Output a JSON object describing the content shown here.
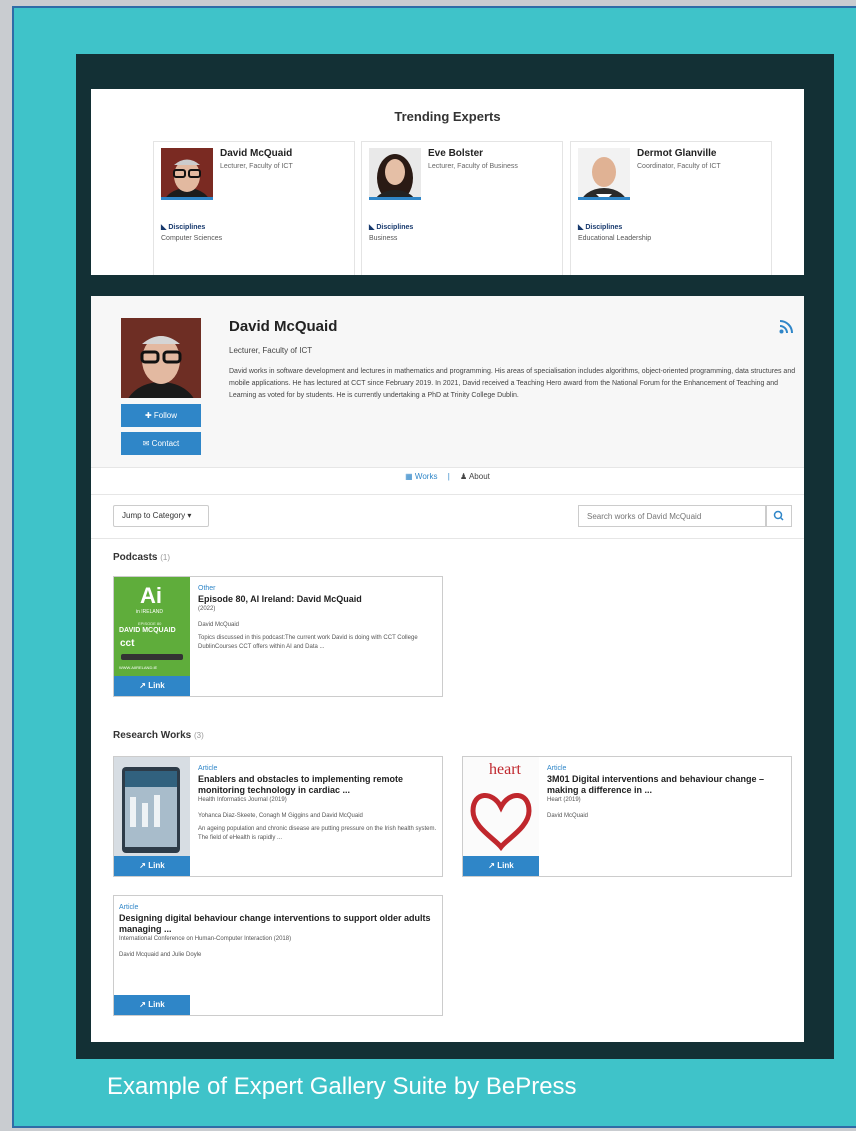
{
  "trending": {
    "title": "Trending Experts",
    "disciplines_label": "Disciplines",
    "experts": [
      {
        "name": "David McQuaid",
        "role": "Lecturer, Faculty of ICT",
        "discipline": "Computer Sciences"
      },
      {
        "name": "Eve Bolster",
        "role": "Lecturer, Faculty of Business",
        "discipline": "Business"
      },
      {
        "name": "Dermot Glanville",
        "role": "Coordinator, Faculty of ICT",
        "discipline": "Educational Leadership"
      }
    ]
  },
  "profile": {
    "name": "David McQuaid",
    "role": "Lecturer, Faculty of ICT",
    "bio": "David works in software development and lectures in mathematics and programming. His areas of specialisation includes algorithms, object-oriented programming, data structures and mobile applications. He has lectured at CCT since February 2019. In 2021, David received a Teaching Hero award from the National Forum for the Enhancement of Teaching and Learning as voted for by students. He is currently undertaking a PhD at Trinity College Dublin.",
    "follow_label": "Follow",
    "contact_label": "Contact"
  },
  "tabs": {
    "works": "Works",
    "about": "About"
  },
  "toolbar": {
    "jump": "Jump to Category",
    "search_placeholder": "Search works of David McQuaid"
  },
  "podcasts": {
    "title": "Podcasts",
    "count": "(1)",
    "items": [
      {
        "type": "Other",
        "title": "Episode 80, AI Ireland: David McQuaid",
        "year": "(2022)",
        "authors": "David McQuaid",
        "abstract": "Topics discussed in this podcast:The current work David is doing with CCT College DublinCourses CCT offers within AI and Data ...",
        "link": "Link",
        "thumb": {
          "logo": "Ai",
          "sub": "in IRELAND",
          "ep": "EPISODE 80",
          "name": "DAVID MCQUAID",
          "brand": "cct",
          "url": "WWW.AIIRELAND.IE"
        }
      }
    ]
  },
  "research": {
    "title": "Research Works",
    "count": "(3)",
    "items": [
      {
        "type": "Article",
        "title": "Enablers and obstacles to implementing remote monitoring technology in cardiac ...",
        "year": "Health Informatics Journal (2019)",
        "authors": "Yohanca Diaz-Skeete, Conagh M Giggins and David McQuaid",
        "abstract": "An ageing population and chronic disease are putting pressure on the Irish health system. The field of eHealth is rapidly ...",
        "link": "Link"
      },
      {
        "type": "Article",
        "title": "3M01 Digital interventions and behaviour change – making a difference in ...",
        "year": "Heart (2019)",
        "authors": "David McQuaid",
        "abstract": "",
        "link": "Link",
        "thumb_word": "heart"
      },
      {
        "type": "Article",
        "title": "Designing digital behaviour change interventions to support older adults managing ...",
        "year": "International Conference on Human-Computer Interaction (2018)",
        "authors": "David Mcquaid and Julie Doyle",
        "abstract": "",
        "link": "Link"
      }
    ]
  },
  "caption": "Example of Expert Gallery Suite by BePress",
  "colors": {
    "accent": "#2f86c8",
    "frame": "#3fc3c9",
    "dark": "#133035"
  }
}
